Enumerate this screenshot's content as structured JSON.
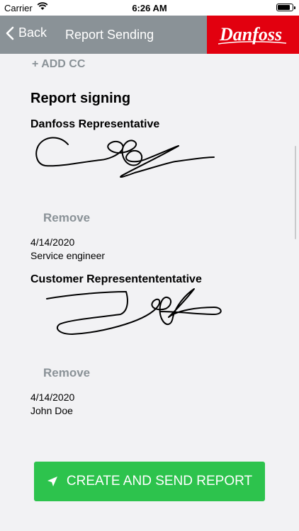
{
  "status_bar": {
    "carrier": "Carrier",
    "time": "6:26 AM",
    "battery_level": 0.9
  },
  "nav": {
    "back_label": "Back",
    "title": "Report Sending",
    "logo_text": "Danfoss",
    "color": "#8a9297"
  },
  "add_cc_label": "+ ADD CC",
  "signing": {
    "title": "Report signing",
    "danfoss": {
      "label": "Danfoss Representative",
      "remove_label": "Remove",
      "date": "4/14/2020",
      "role": "Service engineer"
    },
    "customer": {
      "label": "Customer Representententative",
      "remove_label": "Remove",
      "date": "4/14/2020",
      "name": "John Doe"
    }
  },
  "send_button": {
    "label": "CREATE AND SEND REPORT",
    "color": "#2dc34d"
  },
  "icons": {
    "back": "chevron-left-icon",
    "wifi": "wifi-icon",
    "battery": "battery-icon",
    "send": "paper-plane-icon"
  }
}
